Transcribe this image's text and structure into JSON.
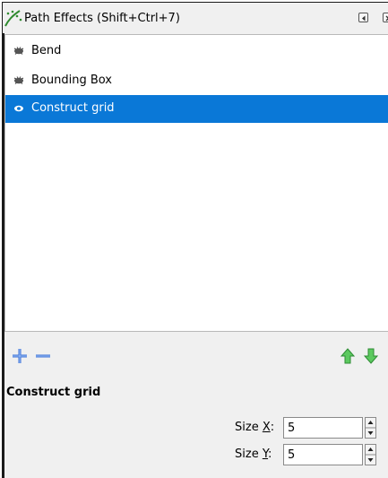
{
  "window": {
    "title": "Path Effects  (Shift+Ctrl+7)"
  },
  "effects": [
    {
      "label": "Bend",
      "visible": true,
      "selected": false
    },
    {
      "label": "Bounding Box",
      "visible": true,
      "selected": false
    },
    {
      "label": "Construct grid",
      "visible": true,
      "selected": true
    }
  ],
  "toolbar": {
    "add": "plus-icon",
    "remove": "minus-icon",
    "up": "arrow-up-icon",
    "down": "arrow-down-icon"
  },
  "params": {
    "title": "Construct grid",
    "size_x": {
      "label_prefix": "Size ",
      "label_key": "X",
      "label_suffix": ":",
      "value": "5"
    },
    "size_y": {
      "label_prefix": "Size ",
      "label_key": "Y",
      "label_suffix": ":",
      "value": "5"
    }
  },
  "colors": {
    "selection": "#0a78d7",
    "add_remove": "#3a6fd8",
    "arrows": "#3fb54a"
  }
}
